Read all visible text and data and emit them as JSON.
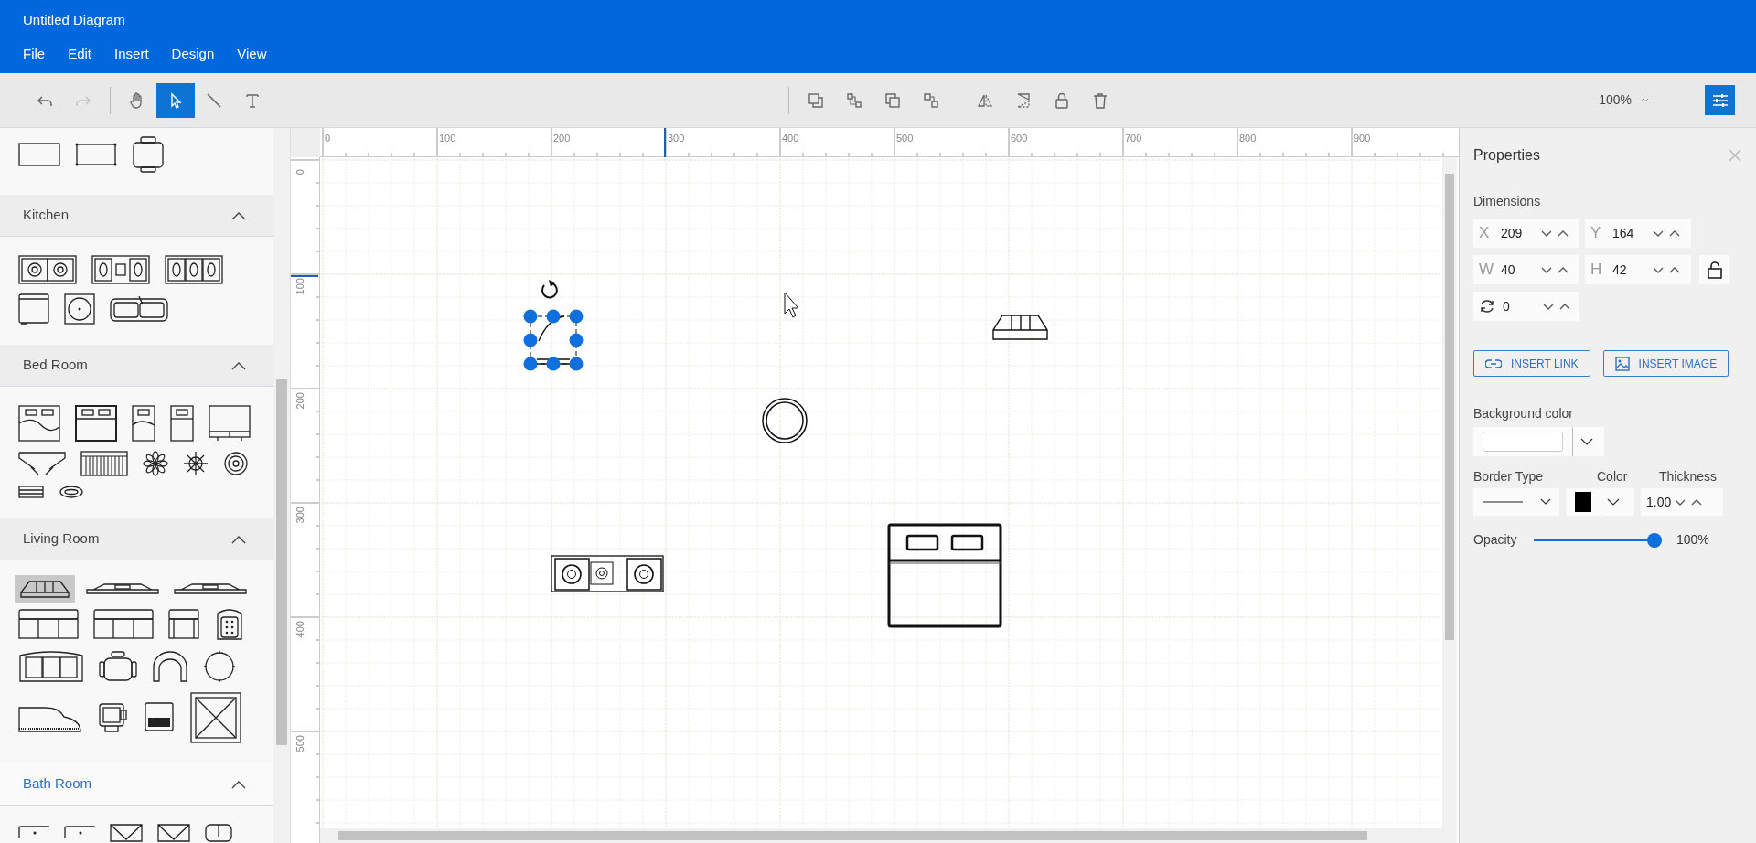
{
  "window": {
    "title": "Untitled Diagram"
  },
  "menu": [
    {
      "label": "File"
    },
    {
      "label": "Edit"
    },
    {
      "label": "Insert"
    },
    {
      "label": "Design"
    },
    {
      "label": "View"
    }
  ],
  "toolbar": {
    "left": [
      {
        "kind": "undo",
        "disabled": false,
        "selected": false
      },
      {
        "kind": "redo",
        "disabled": true,
        "selected": false
      },
      {
        "kind": "sep"
      },
      {
        "kind": "pan",
        "disabled": false,
        "selected": false
      },
      {
        "kind": "select",
        "disabled": false,
        "selected": true
      },
      {
        "kind": "line",
        "disabled": false,
        "selected": false
      },
      {
        "kind": "text",
        "disabled": false,
        "selected": false
      }
    ],
    "center": [
      {
        "kind": "sep"
      },
      {
        "kind": "front",
        "disabled": false,
        "selected": false
      },
      {
        "kind": "group",
        "disabled": false,
        "selected": false
      },
      {
        "kind": "back",
        "disabled": false,
        "selected": false
      },
      {
        "kind": "ungroup",
        "disabled": false,
        "selected": false
      },
      {
        "kind": "sep"
      },
      {
        "kind": "fliph",
        "disabled": false,
        "selected": false
      },
      {
        "kind": "flipv",
        "disabled": false,
        "selected": false
      },
      {
        "kind": "lock",
        "disabled": false,
        "selected": false
      },
      {
        "kind": "delete",
        "disabled": false,
        "selected": false
      }
    ],
    "zoom": "100%",
    "properties_toggle": {
      "selected": true
    }
  },
  "palette": [
    {
      "items": [
        {
          "kind": "rect",
          "selected": false
        },
        {
          "kind": "rect-dots",
          "selected": false
        },
        {
          "kind": "chair-table",
          "selected": false
        }
      ]
    },
    {
      "title": "Kitchen",
      "expanded": true,
      "active": false,
      "items": [
        {
          "kind": "stove2",
          "selected": false
        },
        {
          "kind": "stove3a",
          "selected": false
        },
        {
          "kind": "stove3b",
          "selected": false
        },
        {
          "kind": "fridge",
          "selected": false
        },
        {
          "kind": "washer",
          "selected": false
        },
        {
          "kind": "sink",
          "selected": false
        }
      ]
    },
    {
      "title": "Bed Room",
      "expanded": true,
      "active": false,
      "items": [
        {
          "kind": "bed-double",
          "selected": false
        },
        {
          "kind": "bed-double2",
          "selected": false
        },
        {
          "kind": "bed-single",
          "selected": false
        },
        {
          "kind": "bed-single2",
          "selected": false
        },
        {
          "kind": "wardrobe",
          "selected": false
        },
        {
          "kind": "dresser",
          "selected": false
        },
        {
          "kind": "radiator",
          "selected": false
        },
        {
          "kind": "flower",
          "selected": false
        },
        {
          "kind": "star",
          "selected": false
        },
        {
          "kind": "ring",
          "selected": false
        },
        {
          "kind": "shelf",
          "selected": false
        },
        {
          "kind": "oval",
          "selected": false
        }
      ]
    },
    {
      "title": "Living Room",
      "expanded": true,
      "active": false,
      "items": [
        {
          "kind": "sofa-small",
          "selected": true
        },
        {
          "kind": "tv",
          "selected": false
        },
        {
          "kind": "tv",
          "selected": false
        },
        {
          "kind": "couch3",
          "selected": false
        },
        {
          "kind": "couch3",
          "selected": false
        },
        {
          "kind": "armchair",
          "selected": false
        },
        {
          "kind": "chair-dots",
          "selected": false
        },
        {
          "kind": "sofa-dots",
          "selected": false
        },
        {
          "kind": "chair-round",
          "selected": false
        },
        {
          "kind": "chair-arc",
          "selected": false
        },
        {
          "kind": "round-table",
          "selected": false
        },
        {
          "kind": "piano",
          "selected": false
        },
        {
          "kind": "desk",
          "selected": false
        },
        {
          "kind": "laptop",
          "selected": false
        },
        {
          "kind": "cross-box",
          "selected": false
        }
      ]
    },
    {
      "title": "Bath Room",
      "expanded": true,
      "active": true,
      "items": [
        {
          "kind": "tub",
          "selected": false
        },
        {
          "kind": "tub",
          "selected": false
        },
        {
          "kind": "tri-box",
          "selected": false
        },
        {
          "kind": "tri-box",
          "selected": false
        },
        {
          "kind": "toilet",
          "selected": false
        }
      ]
    }
  ],
  "rulers": {
    "horizontal": [
      "0",
      "100",
      "200",
      "300",
      "400",
      "500",
      "600",
      "700",
      "800",
      "900"
    ],
    "vertical": [
      "0",
      "100",
      "200",
      "300",
      "400",
      "500"
    ]
  },
  "properties": {
    "title": "Properties",
    "dimensions_label": "Dimensions",
    "fields": [
      {
        "kind": "label",
        "label": "X",
        "value": "209"
      },
      {
        "kind": "label",
        "label": "Y",
        "value": "164"
      },
      {
        "kind": "label",
        "label": "W",
        "value": "40"
      },
      {
        "kind": "label",
        "label": "H",
        "value": "42"
      },
      {
        "kind": "rotation",
        "value": "0"
      }
    ],
    "aspect_locked": false,
    "buttons": [
      {
        "kind": "link",
        "label": "INSERT LINK"
      },
      {
        "kind": "image",
        "label": "INSERT IMAGE"
      }
    ],
    "background_label": "Background color",
    "border_type_label": "Border Type",
    "color_label": "Color",
    "thickness_label": "Thickness",
    "thickness": "1.00",
    "opacity_label": "Opacity",
    "opacity": {
      "level": 1.0
    },
    "opacity_reading": "100%"
  }
}
